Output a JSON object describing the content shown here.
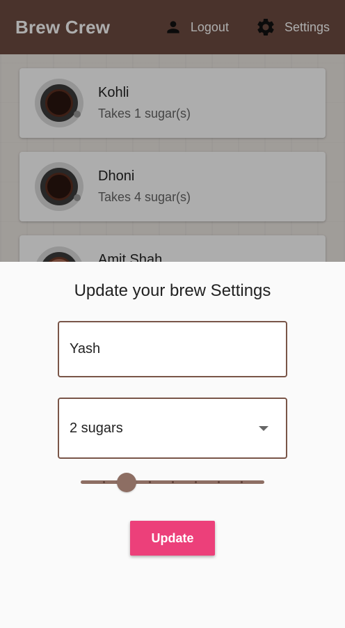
{
  "appbar": {
    "title": "Brew Crew",
    "logout_label": "Logout",
    "settings_label": "Settings",
    "logout_icon": "person-icon",
    "settings_icon": "gear-icon"
  },
  "brews": [
    {
      "name": "Kohli",
      "sugars_text": "Takes 1 sugar(s)"
    },
    {
      "name": "Dhoni",
      "sugars_text": "Takes 4 sugar(s)"
    },
    {
      "name": "Amit Shah",
      "sugars_text": ""
    }
  ],
  "sheet": {
    "title": "Update your brew Settings",
    "name_value": "Yash",
    "sugar_value": "2 sugars",
    "strength": {
      "value": 300,
      "min": 100,
      "max": 900,
      "divisions": 8
    },
    "update_label": "Update"
  },
  "colors": {
    "primary": "#6d4c41",
    "field_border": "#795548",
    "slider": "#8d6e63",
    "button": "#ec407a"
  }
}
